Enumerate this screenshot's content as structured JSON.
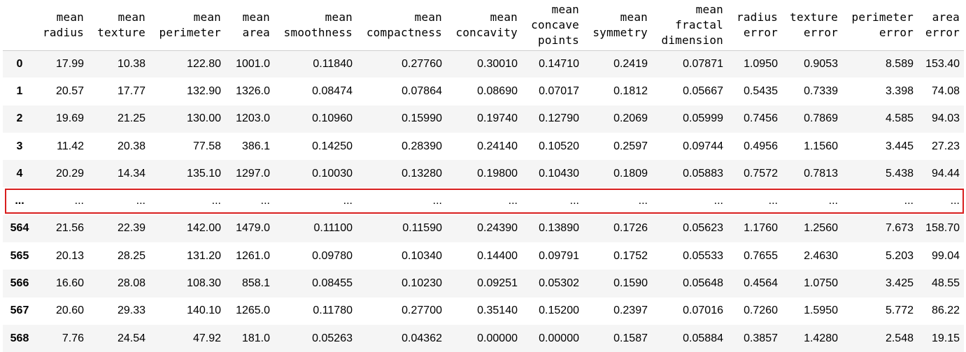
{
  "table": {
    "columns": [
      "mean radius",
      "mean texture",
      "mean perimeter",
      "mean area",
      "mean smoothness",
      "mean compactness",
      "mean concavity",
      "mean concave points",
      "mean symmetry",
      "mean fractal dimension",
      "radius error",
      "texture error",
      "perimeter error",
      "area error"
    ],
    "rows": [
      {
        "index": "0",
        "cells": [
          "17.99",
          "10.38",
          "122.80",
          "1001.0",
          "0.11840",
          "0.27760",
          "0.30010",
          "0.14710",
          "0.2419",
          "0.07871",
          "1.0950",
          "0.9053",
          "8.589",
          "153.40"
        ]
      },
      {
        "index": "1",
        "cells": [
          "20.57",
          "17.77",
          "132.90",
          "1326.0",
          "0.08474",
          "0.07864",
          "0.08690",
          "0.07017",
          "0.1812",
          "0.05667",
          "0.5435",
          "0.7339",
          "3.398",
          "74.08"
        ]
      },
      {
        "index": "2",
        "cells": [
          "19.69",
          "21.25",
          "130.00",
          "1203.0",
          "0.10960",
          "0.15990",
          "0.19740",
          "0.12790",
          "0.2069",
          "0.05999",
          "0.7456",
          "0.7869",
          "4.585",
          "94.03"
        ]
      },
      {
        "index": "3",
        "cells": [
          "11.42",
          "20.38",
          "77.58",
          "386.1",
          "0.14250",
          "0.28390",
          "0.24140",
          "0.10520",
          "0.2597",
          "0.09744",
          "0.4956",
          "1.1560",
          "3.445",
          "27.23"
        ]
      },
      {
        "index": "4",
        "cells": [
          "20.29",
          "14.34",
          "135.10",
          "1297.0",
          "0.10030",
          "0.13280",
          "0.19800",
          "0.10430",
          "0.1809",
          "0.05883",
          "0.7572",
          "0.7813",
          "5.438",
          "94.44"
        ]
      },
      {
        "index": "...",
        "cells": [
          "...",
          "...",
          "...",
          "...",
          "...",
          "...",
          "...",
          "...",
          "...",
          "...",
          "...",
          "...",
          "...",
          "..."
        ]
      },
      {
        "index": "564",
        "cells": [
          "21.56",
          "22.39",
          "142.00",
          "1479.0",
          "0.11100",
          "0.11590",
          "0.24390",
          "0.13890",
          "0.1726",
          "0.05623",
          "1.1760",
          "1.2560",
          "7.673",
          "158.70"
        ]
      },
      {
        "index": "565",
        "cells": [
          "20.13",
          "28.25",
          "131.20",
          "1261.0",
          "0.09780",
          "0.10340",
          "0.14400",
          "0.09791",
          "0.1752",
          "0.05533",
          "0.7655",
          "2.4630",
          "5.203",
          "99.04"
        ]
      },
      {
        "index": "566",
        "cells": [
          "16.60",
          "28.08",
          "108.30",
          "858.1",
          "0.08455",
          "0.10230",
          "0.09251",
          "0.05302",
          "0.1590",
          "0.05648",
          "0.4564",
          "1.0750",
          "3.425",
          "48.55"
        ]
      },
      {
        "index": "567",
        "cells": [
          "20.60",
          "29.33",
          "140.10",
          "1265.0",
          "0.11780",
          "0.27700",
          "0.35140",
          "0.15200",
          "0.2397",
          "0.07016",
          "0.7260",
          "1.5950",
          "5.772",
          "86.22"
        ]
      },
      {
        "index": "568",
        "cells": [
          "7.76",
          "24.54",
          "47.92",
          "181.0",
          "0.05263",
          "0.04362",
          "0.00000",
          "0.00000",
          "0.1587",
          "0.05884",
          "0.3857",
          "1.4280",
          "2.548",
          "19.15"
        ]
      }
    ]
  },
  "highlight": {
    "color": "#d81e1e",
    "row_index_label": "..."
  }
}
